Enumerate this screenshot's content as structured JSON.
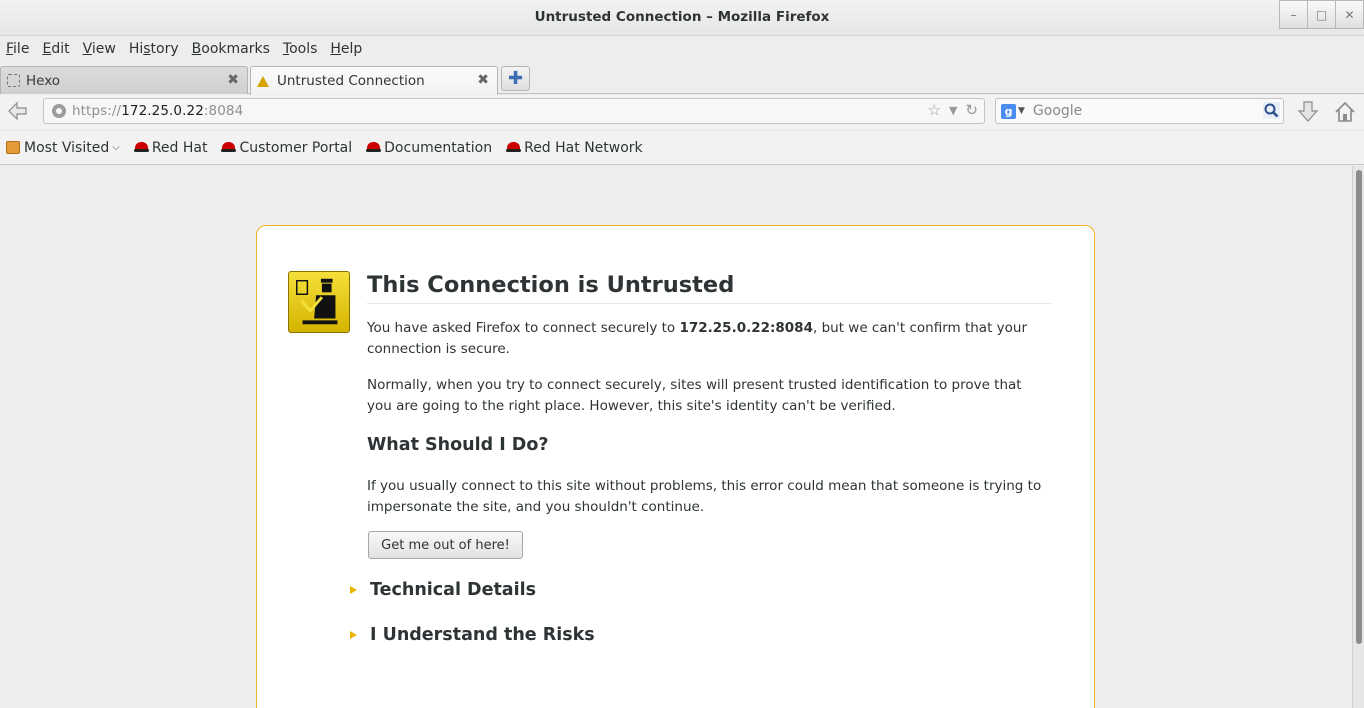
{
  "window": {
    "title": "Untrusted Connection – Mozilla Firefox"
  },
  "menu": [
    {
      "pre": "",
      "u": "F",
      "post": "ile"
    },
    {
      "pre": "",
      "u": "E",
      "post": "dit"
    },
    {
      "pre": "",
      "u": "V",
      "post": "iew"
    },
    {
      "pre": "Hi",
      "u": "s",
      "post": "tory"
    },
    {
      "pre": "",
      "u": "B",
      "post": "ookmarks"
    },
    {
      "pre": "",
      "u": "T",
      "post": "ools"
    },
    {
      "pre": "",
      "u": "H",
      "post": "elp"
    }
  ],
  "tabs": [
    {
      "label": "Hexo",
      "icon": "blank-page-icon",
      "active": false
    },
    {
      "label": "Untrusted Connection",
      "icon": "warning-icon",
      "active": true
    }
  ],
  "urlbar": {
    "scheme": "https://",
    "host": "172.25.0.22",
    "port": ":8084"
  },
  "search": {
    "placeholder": "Google",
    "engine_icon": "google-icon"
  },
  "bookmarks": [
    {
      "label": "Most Visited",
      "icon": "folder-icon"
    },
    {
      "label": "Red Hat",
      "icon": "redhat-icon"
    },
    {
      "label": "Customer Portal",
      "icon": "redhat-icon"
    },
    {
      "label": "Documentation",
      "icon": "redhat-icon"
    },
    {
      "label": "Red Hat Network",
      "icon": "redhat-icon"
    }
  ],
  "error_page": {
    "title": "This Connection is Untrusted",
    "p1_a": "You have asked Firefox to connect securely to ",
    "p1_host": "172.25.0.22:8084",
    "p1_b": ", but we can't confirm that your connection is secure.",
    "p2": "Normally, when you try to connect securely, sites will present trusted identification to prove that you are going to the right place. However, this site's identity can't be verified.",
    "what_heading": "What Should I Do?",
    "p3": "If you usually connect to this site without problems, this error could mean that someone is trying to impersonate the site, and you shouldn't continue.",
    "escape_button": "Get me out of here!",
    "technical_details": "Technical Details",
    "understand_risks": "I Understand the Risks"
  },
  "colors": {
    "accent_border": "#f0b325",
    "icon_yellow": "#d4b400"
  }
}
